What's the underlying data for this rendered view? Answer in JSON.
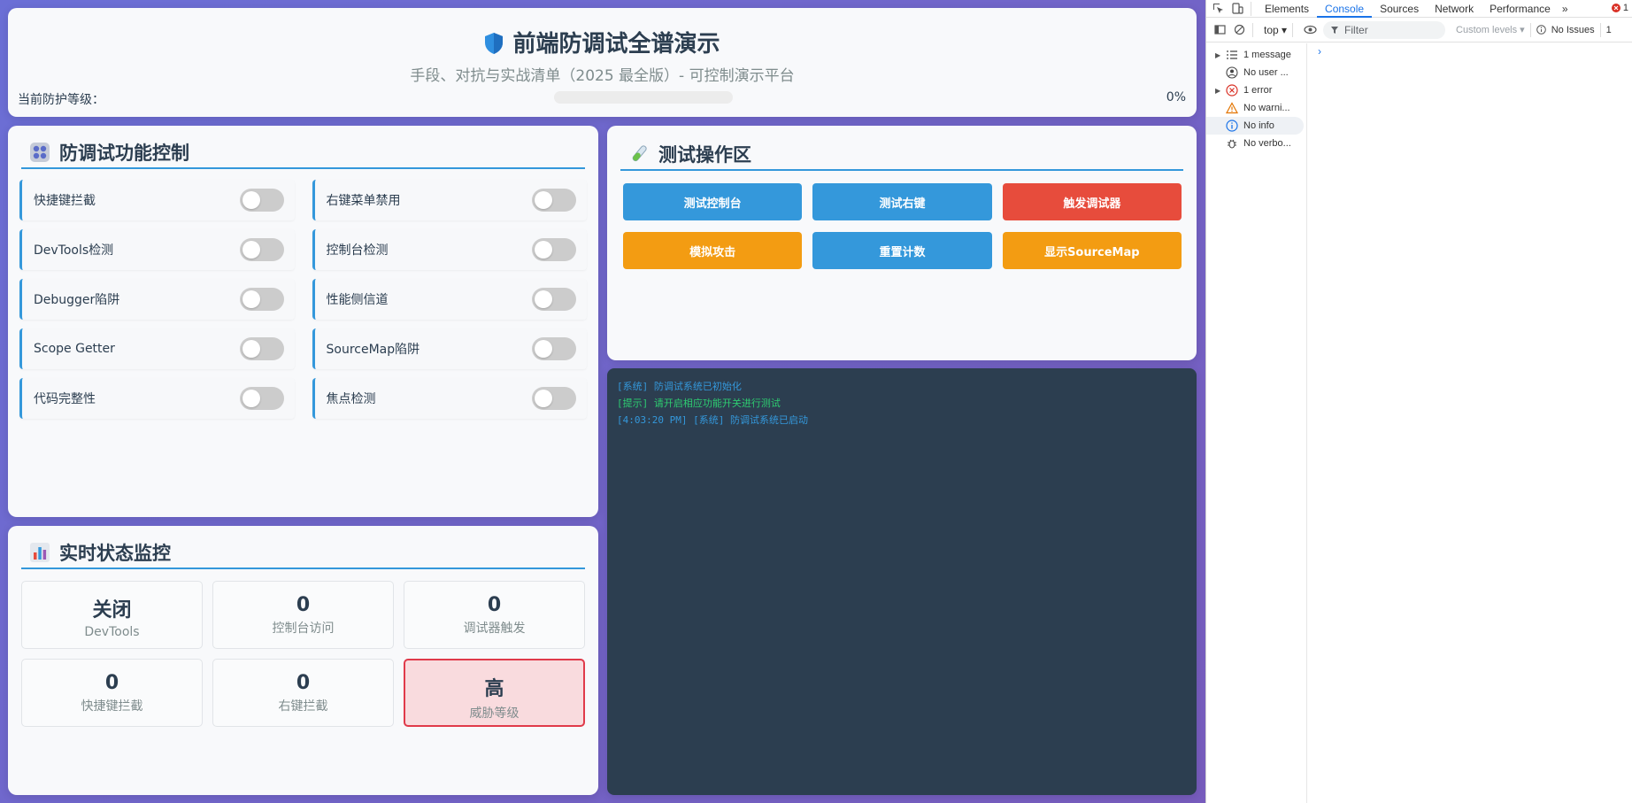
{
  "header": {
    "title": "前端防调试全谱演示",
    "subtitle": "手段、对抗与实战清单（2025 最全版）- 可控制演示平台",
    "level_label": "当前防护等级：",
    "level_value": "0%",
    "level_fraction": 0
  },
  "controls": {
    "title": "防调试功能控制",
    "items": [
      {
        "label": "快捷键拦截",
        "on": false
      },
      {
        "label": "右键菜单禁用",
        "on": false
      },
      {
        "label": "DevTools检测",
        "on": false
      },
      {
        "label": "控制台检测",
        "on": false
      },
      {
        "label": "Debugger陷阱",
        "on": false
      },
      {
        "label": "性能侧信道",
        "on": false
      },
      {
        "label": "Scope Getter",
        "on": false
      },
      {
        "label": "SourceMap陷阱",
        "on": false
      },
      {
        "label": "代码完整性",
        "on": false
      },
      {
        "label": "焦点检测",
        "on": false
      }
    ]
  },
  "ops": {
    "title": "测试操作区",
    "buttons": [
      {
        "label": "测试控制台",
        "color": "#3498db"
      },
      {
        "label": "测试右键",
        "color": "#3498db"
      },
      {
        "label": "触发调试器",
        "color": "#e74c3c"
      },
      {
        "label": "模拟攻击",
        "color": "#f39c12"
      },
      {
        "label": "重置计数",
        "color": "#3498db"
      },
      {
        "label": "显示SourceMap",
        "color": "#f39c12"
      }
    ]
  },
  "log": {
    "lines": [
      {
        "text": "[系统] 防调试系统已初始化",
        "color": "#3498db"
      },
      {
        "text": "[提示] 请开启相应功能开关进行测试",
        "color": "#2ecc71"
      },
      {
        "text": "[4:03:20 PM] [系统] 防调试系统已启动",
        "color": "#3498db"
      }
    ]
  },
  "monitor": {
    "title": "实时状态监控",
    "stats": [
      {
        "value": "关闭",
        "label": "DevTools"
      },
      {
        "value": "0",
        "label": "控制台访问"
      },
      {
        "value": "0",
        "label": "调试器触发"
      },
      {
        "value": "0",
        "label": "快捷键拦截"
      },
      {
        "value": "0",
        "label": "右键拦截"
      },
      {
        "value": "高",
        "label": "威胁等级",
        "danger": true
      }
    ]
  },
  "devtools": {
    "tabs": [
      "Elements",
      "Console",
      "Sources",
      "Network",
      "Performance"
    ],
    "active_tab": "Console",
    "more_tabs": "»",
    "error_count": "1",
    "context": "top ▾",
    "filter_placeholder": "Filter",
    "levels": "Custom levels ▾",
    "issues": "No Issues",
    "issues_trunc": "1",
    "sidebar": [
      {
        "label": "1 message",
        "icon": "list-icon",
        "arrow": true
      },
      {
        "label": "No user ...",
        "icon": "user-icon",
        "arrow": false
      },
      {
        "label": "1 error",
        "icon": "error-icon",
        "arrow": true
      },
      {
        "label": "No warni...",
        "icon": "warning-icon",
        "arrow": false
      },
      {
        "label": "No info",
        "icon": "info-icon",
        "arrow": false,
        "selected": true
      },
      {
        "label": "No verbo...",
        "icon": "bug-icon",
        "arrow": false
      }
    ],
    "prompt": "›"
  },
  "colors": {
    "accent": "#3498db",
    "danger": "#e74c3c",
    "warning": "#f39c12",
    "log_bg": "#2c3e50"
  }
}
